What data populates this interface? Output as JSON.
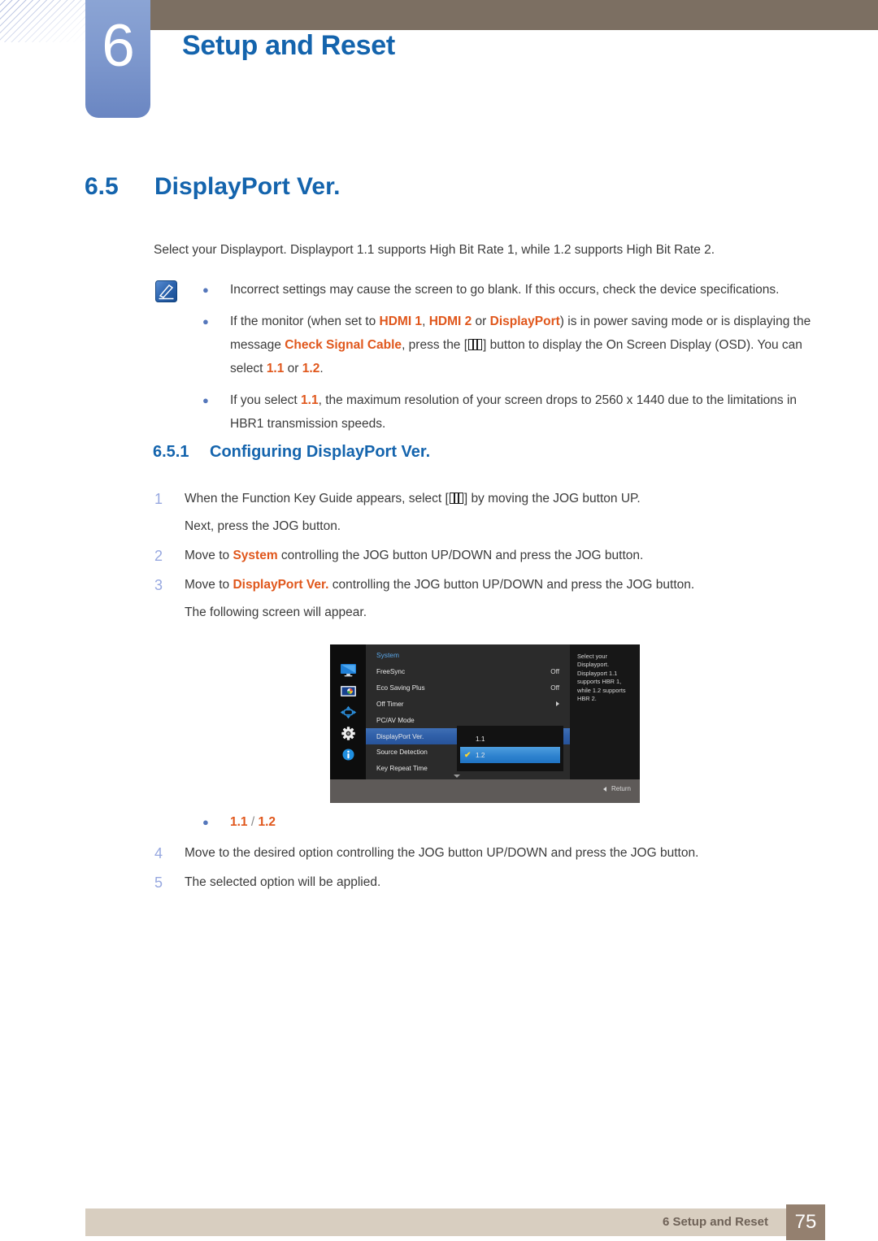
{
  "chapter": {
    "number": "6",
    "title": "Setup and Reset"
  },
  "section": {
    "number": "6.5",
    "title": "DisplayPort Ver."
  },
  "intro": "Select your Displayport. Displayport 1.1 supports High Bit Rate 1, while 1.2 supports High Bit Rate 2.",
  "note": {
    "icon": "note-pencil-icon",
    "bullet_glyph": "●",
    "items": [
      {
        "parts": [
          {
            "t": "Incorrect settings may cause the screen to go blank. If this occurs, check the device specifications."
          }
        ]
      },
      {
        "parts": [
          {
            "t": "If the monitor (when set to "
          },
          {
            "t": "HDMI 1",
            "hl": true
          },
          {
            "t": ", "
          },
          {
            "t": "HDMI 2",
            "hl": true
          },
          {
            "t": " or "
          },
          {
            "t": "DisplayPort",
            "hl": true
          },
          {
            "t": ") is in power saving mode or is displaying the message "
          },
          {
            "t": "Check Signal Cable",
            "hl": true
          },
          {
            "t": ", press the ["
          },
          {
            "t": "",
            "key": true
          },
          {
            "t": "] button to display the On Screen Display (OSD). You can select "
          },
          {
            "t": "1.1",
            "hl": true
          },
          {
            "t": " or "
          },
          {
            "t": "1.2",
            "hl": true
          },
          {
            "t": "."
          }
        ]
      },
      {
        "parts": [
          {
            "t": "If you select "
          },
          {
            "t": "1.1",
            "hl": true
          },
          {
            "t": ", the maximum resolution of your screen drops to 2560 x 1440 due to the limitations in HBR1 transmission speeds."
          }
        ]
      }
    ]
  },
  "subsection": {
    "number": "6.5.1",
    "title": "Configuring DisplayPort Ver."
  },
  "steps_top": [
    {
      "num": "1",
      "parts": [
        {
          "t": "When the Function Key Guide appears, select ["
        },
        {
          "t": "",
          "key": true
        },
        {
          "t": "] by moving the JOG button UP."
        }
      ],
      "sub": "Next, press the JOG button."
    },
    {
      "num": "2",
      "parts": [
        {
          "t": "Move to "
        },
        {
          "t": "System",
          "hl": true
        },
        {
          "t": " controlling the JOG button UP/DOWN and press the JOG button."
        }
      ],
      "sub": ""
    },
    {
      "num": "3",
      "parts": [
        {
          "t": "Move to "
        },
        {
          "t": "DisplayPort Ver.",
          "hl": true
        },
        {
          "t": " controlling the JOG button UP/DOWN and press the JOG button."
        }
      ],
      "sub": "The following screen will appear."
    }
  ],
  "options_bullet": {
    "bullet_glyph": "●",
    "parts": [
      {
        "t": "1.1",
        "hl": true
      },
      {
        "t": " / "
      },
      {
        "t": "1.2",
        "hl": true
      }
    ]
  },
  "steps_bottom": [
    {
      "num": "4",
      "parts": [
        {
          "t": "Move to the desired option controlling the JOG button UP/DOWN and press the JOG button."
        }
      ],
      "sub": ""
    },
    {
      "num": "5",
      "parts": [
        {
          "t": "The selected option will be applied."
        }
      ],
      "sub": ""
    }
  ],
  "osd": {
    "category": "System",
    "rail_icons": [
      {
        "name": "display-monitor-icon",
        "selected": false
      },
      {
        "name": "picture-color-icon",
        "selected": false
      },
      {
        "name": "pip-position-arrows-icon",
        "selected": false
      },
      {
        "name": "system-gear-icon",
        "selected": true
      },
      {
        "name": "information-icon",
        "selected": false
      }
    ],
    "rows": [
      {
        "label": "FreeSync",
        "value": "Off",
        "arrow": false,
        "selected": false
      },
      {
        "label": "Eco Saving Plus",
        "value": "Off",
        "arrow": false,
        "selected": false
      },
      {
        "label": "Off Timer",
        "value": "",
        "arrow": true,
        "selected": false
      },
      {
        "label": "PC/AV Mode",
        "value": "",
        "arrow": false,
        "selected": false
      },
      {
        "label": "DisplayPort Ver.",
        "value": "",
        "arrow": false,
        "selected": true
      },
      {
        "label": "Source Detection",
        "value": "",
        "arrow": false,
        "selected": false
      },
      {
        "label": "Key Repeat Time",
        "value": "",
        "arrow": false,
        "selected": false
      }
    ],
    "submenu": [
      {
        "label": "1.1",
        "checked": false,
        "selected": false
      },
      {
        "label": "1.2",
        "checked": true,
        "selected": true
      }
    ],
    "check_glyph": "✔",
    "help_text": "Select your Displayport. Displayport 1.1 supports HBR 1, while 1.2 supports HBR 2.",
    "return_label": "Return"
  },
  "footer": {
    "text": "6 Setup and Reset",
    "page": "75"
  },
  "colors": {
    "heading_blue": "#1464ad",
    "highlight_orange": "#e0571c",
    "step_number": "#97a8e0",
    "header_brown": "#7c6f62",
    "footer_bar": "#d8cec0",
    "footer_page_box": "#94806f",
    "osd_select_blue": "#2f5fa8",
    "osd_check_yellow": "#ffd42a"
  }
}
